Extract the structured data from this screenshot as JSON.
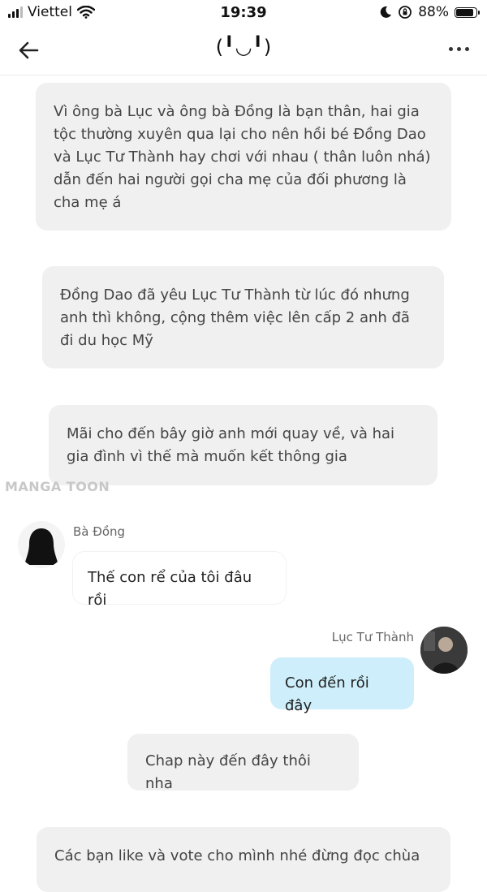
{
  "status": {
    "carrier": "Viettel",
    "time": "19:39",
    "battery": "88%",
    "battery_level": 0.88
  },
  "header": {
    "title": "(╹◡╹)"
  },
  "watermark": "MANGA TOON",
  "messages": {
    "narr1": "Vì ông bà Lục và ông bà Đồng là bạn thân, hai gia tộc thường xuyên qua lại cho nên hồi bé Đồng Dao và Lục Tư Thành hay chơi với nhau ( thân luôn nhá) dẫn đến hai người gọi cha mẹ của đối phương là cha mẹ á",
    "narr2": "Đồng Dao đã yêu Lục Tư Thành từ lúc đó nhưng anh thì không, cộng thêm việc lên cấp 2 anh đã đi du học Mỹ",
    "narr3": "Mãi cho đến bây giờ anh mới quay về, và hai gia đình vì thế mà muốn kết thông gia",
    "left_name": "Bà Đồng",
    "left_text": "Thế con rể của tôi đâu rồi",
    "right_name": "Lục Tư Thành",
    "right_text": "Con đến rồi đây",
    "narr4": "Chap này đến đây thôi nha",
    "narr5": "Các bạn like và vote cho mình nhé đừng đọc chùa"
  }
}
